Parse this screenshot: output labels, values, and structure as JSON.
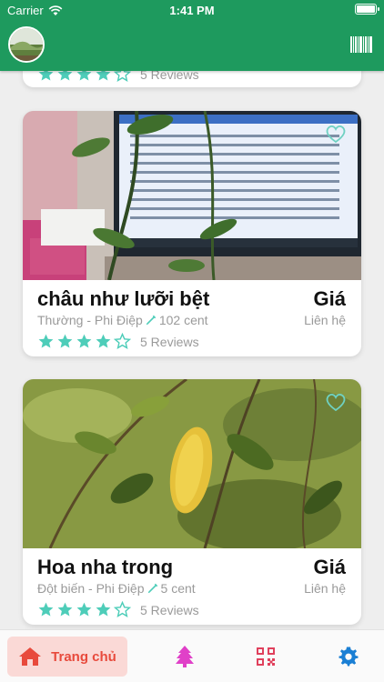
{
  "status_bar": {
    "carrier": "Carrier",
    "time": "1:41 PM"
  },
  "header": {
    "avatar": "avatar",
    "barcode_icon": "barcode-icon"
  },
  "colors": {
    "header": "#1e9a5e",
    "star": "#4ecdb9",
    "active_tab": "#e84a3c",
    "active_tab_bg": "#fad9d6",
    "tree_icon": "#e040c8",
    "qr_icon": "#e0405c",
    "gear_icon": "#1a7fd4"
  },
  "top_partial_card": {
    "reviews": "5 Reviews",
    "rating": 4
  },
  "products": [
    {
      "name": "châu như lưỡi bệt",
      "category": "Thường - Phi Điệp",
      "price_cents": "102 cent",
      "price_label": "Giá",
      "price_sub": "Liên hệ",
      "rating": 4,
      "reviews": "5 Reviews"
    },
    {
      "name": "Hoa nha trong",
      "category": "Đột biến - Phi Điệp",
      "price_cents": "5 cent",
      "price_label": "Giá",
      "price_sub": "Liên hệ",
      "rating": 4,
      "reviews": "5 Reviews"
    }
  ],
  "tabbar": {
    "home_label": "Trang chủ"
  }
}
